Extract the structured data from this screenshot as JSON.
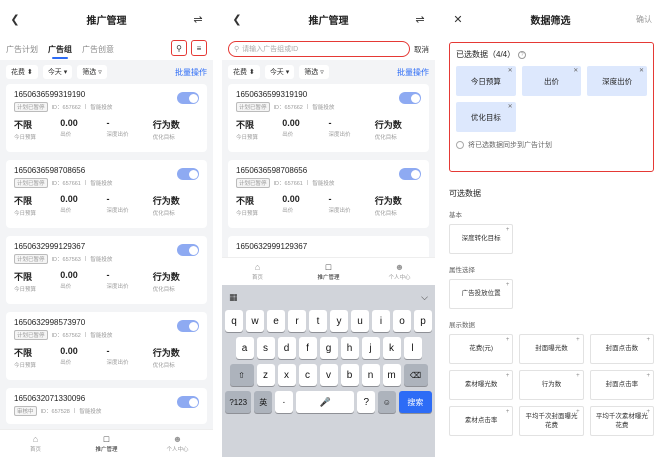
{
  "screen1": {
    "title": "推广管理",
    "tabs": [
      "广告计划",
      "广告组",
      "广告创意"
    ],
    "filters": [
      "花费 ⬍",
      "今天 ▾",
      "筛选 ▿"
    ],
    "batch": "批量操作",
    "cards": [
      {
        "id": "1650636599319190",
        "tag": "计划已暂停",
        "sid": "ID：657662",
        "mode": "智能投放"
      },
      {
        "id": "1650636598708656",
        "tag": "计划已暂停",
        "sid": "ID：657661",
        "mode": "智能投放"
      },
      {
        "id": "1650632999129367",
        "tag": "计划已暂停",
        "sid": "ID：657563",
        "mode": "智能投放"
      },
      {
        "id": "1650632998573970",
        "tag": "计划已暂停",
        "sid": "ID：657562",
        "mode": "智能投放"
      },
      {
        "id": "1650632071330096",
        "tag": "审核中",
        "sid": "ID：657528",
        "mode": "智能投放"
      }
    ],
    "stat_values": [
      "不限",
      "0.00",
      "-",
      "行为数"
    ],
    "stat_labels": [
      "今日预算",
      "出价",
      "深度出价",
      "优化目标"
    ],
    "tabbar": [
      "首页",
      "推广管理",
      "个人中心"
    ]
  },
  "screen2": {
    "title": "推广管理",
    "search_placeholder": "请输入广告组或ID",
    "cancel": "取消",
    "keys_row1": [
      "q",
      "w",
      "e",
      "r",
      "t",
      "y",
      "u",
      "i",
      "o",
      "p"
    ],
    "keys_row2": [
      "a",
      "s",
      "d",
      "f",
      "g",
      "h",
      "j",
      "k",
      "l"
    ],
    "keys_row3": [
      "z",
      "x",
      "c",
      "v",
      "b",
      "n",
      "m"
    ],
    "key_123": "?123",
    "key_lang": "英",
    "key_dot": "·",
    "key_question": "?",
    "key_search": "搜索"
  },
  "screen3": {
    "title": "数据筛选",
    "confirm": "确认",
    "selected_header": "已选数据（4/4）",
    "selected": [
      "今日预算",
      "出价",
      "深度出价",
      "优化目标"
    ],
    "sync_text": "将已选数据同步到广告计划",
    "optional_header": "可选数据",
    "groups": [
      {
        "name": "基本",
        "items": [
          "深度转化目标"
        ]
      },
      {
        "name": "属性选择",
        "items": [
          "广告投放位置"
        ]
      },
      {
        "name": "展示数据",
        "items": [
          "花费(元)",
          "封面曝光数",
          "封面点击数",
          "素材曝光数",
          "行为数",
          "封面点击率",
          "素材点击率",
          "平均千次封面曝光花费",
          "平均千次素材曝光花费"
        ]
      }
    ]
  }
}
